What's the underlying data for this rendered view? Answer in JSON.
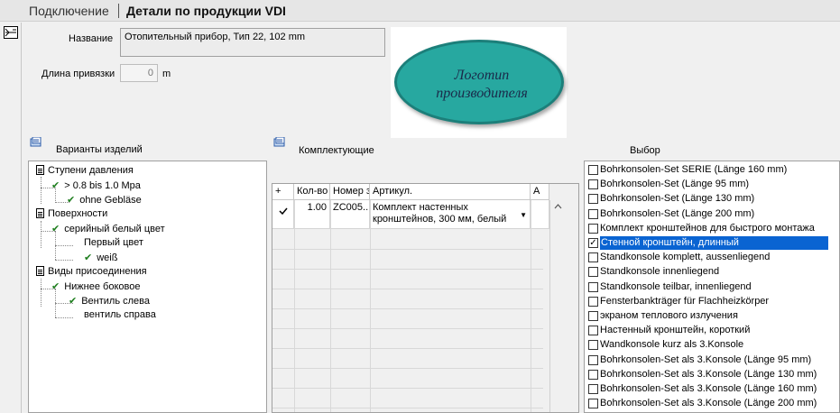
{
  "tabs": {
    "back": "Подключение",
    "current": "Детали по продукции VDI"
  },
  "form": {
    "name_label": "Название",
    "name_value": "Отопительный прибор, Тип 22, 102 mm",
    "length_label": "Длина привязки",
    "length_value": "0",
    "length_unit": "m"
  },
  "logo": {
    "text_line1": "Логотип",
    "text_line2": "производителя",
    "fill": "#27a8a0"
  },
  "variants": {
    "title": "Варианты изделий",
    "groups": [
      {
        "label": "Ступени давления",
        "items": [
          "> 0.8 bis 1.0 Mpa",
          "ohne Gebläse"
        ]
      },
      {
        "label": "Поверхности",
        "items": [
          "серийный белый цвет",
          "Первый цвет",
          "weiß"
        ]
      },
      {
        "label": "Виды присоединения",
        "items": [
          "Нижнее боковое",
          "Вентиль слева",
          "вентиль справа"
        ]
      }
    ]
  },
  "components": {
    "title": "Комплектующие",
    "columns": [
      "+",
      "Кол-во",
      "Номер з",
      "Артикул.",
      "A"
    ],
    "rows": [
      {
        "qty": "1.00",
        "number": "ZC005...",
        "article_line1": "Комплект настенных",
        "article_line2": "кронштейнов, 300 мм, белый"
      }
    ]
  },
  "selection": {
    "title": "Выбор",
    "items": [
      {
        "label": "Bohrkonsolen-Set SERIE (Länge 160 mm)",
        "checked": false
      },
      {
        "label": "Bohrkonsolen-Set (Länge 95 mm)",
        "checked": false
      },
      {
        "label": "Bohrkonsolen-Set (Länge 130 mm)",
        "checked": false
      },
      {
        "label": "Bohrkonsolen-Set (Länge 200 mm)",
        "checked": false
      },
      {
        "label": "Комплект кронштейнов для быстрого монтажа",
        "checked": false
      },
      {
        "label": "Стенной кронштейн, длинный",
        "checked": true
      },
      {
        "label": "Standkonsole komplett, aussenliegend",
        "checked": false
      },
      {
        "label": "Standkonsole innenliegend",
        "checked": false
      },
      {
        "label": "Standkonsole teilbar, innenliegend",
        "checked": false
      },
      {
        "label": "Fensterbankträger für Flachheizkörper",
        "checked": false
      },
      {
        "label": "экраном теплового излучения",
        "checked": false
      },
      {
        "label": "Настенный кронштейн, короткий",
        "checked": false
      },
      {
        "label": "Wandkonsole kurz als 3.Konsole",
        "checked": false
      },
      {
        "label": "Bohrkonsolen-Set als 3.Konsole (Länge 95 mm)",
        "checked": false
      },
      {
        "label": "Bohrkonsolen-Set als 3.Konsole (Länge 130 mm)",
        "checked": false
      },
      {
        "label": "Bohrkonsolen-Set als 3.Konsole (Länge 160 mm)",
        "checked": false
      },
      {
        "label": "Bohrkonsolen-Set als 3.Konsole (Länge 200 mm)",
        "checked": false
      }
    ]
  }
}
